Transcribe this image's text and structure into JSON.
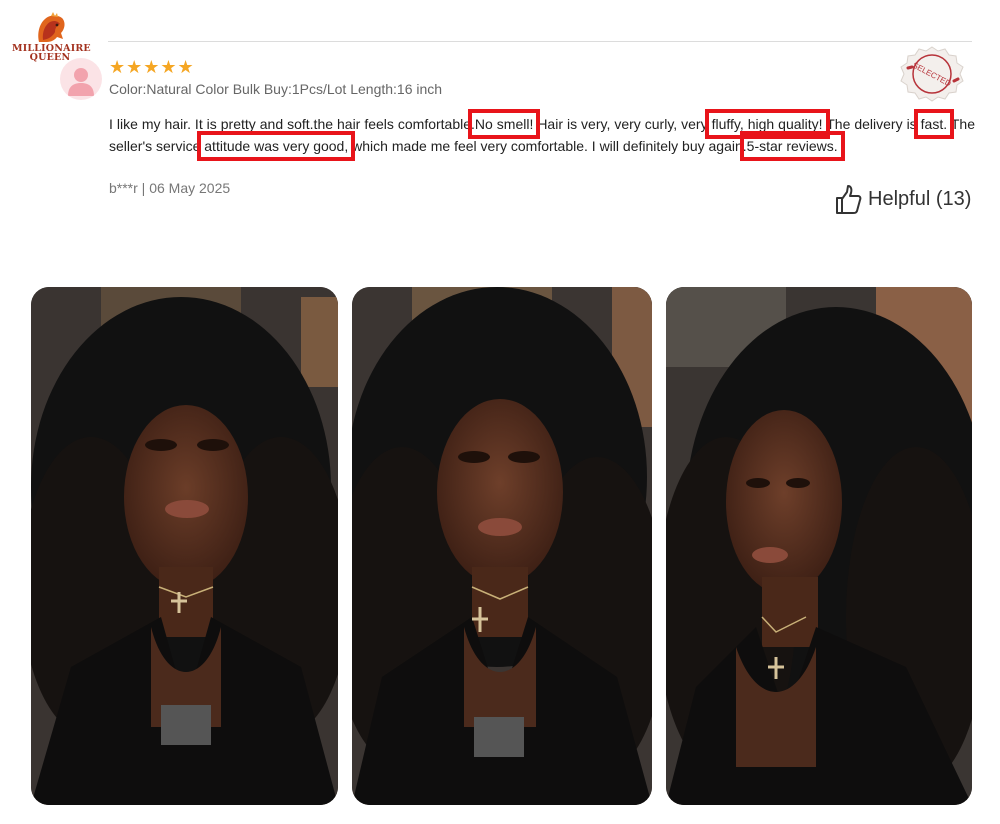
{
  "brand": {
    "line1": "MILLIONAIRE",
    "line2": "QUEEN"
  },
  "review": {
    "rating": 5,
    "stars": "★★★★★",
    "variant": "Color:Natural Color Bulk Buy:1Pcs/Lot Length:16 inch",
    "text": {
      "p1": "I like my hair. It is pretty and soft.the hair feels comfortable.",
      "h1": "No smell!",
      "p2": " Hair is very, very curly, very ",
      "h2": "fluffy, high quality!",
      "p3": " The delivery is ",
      "h3": "fast.",
      "p4": " The seller's service ",
      "h4": "attitude was very good,",
      "p5": " which made me feel very comfortable. I will definitely buy again.",
      "h5": "5-star reviews."
    },
    "author": "b***r",
    "separator": " | ",
    "date": "06 May 2025",
    "badge": "SELECTED",
    "helpful": "Helpful (13)"
  },
  "colors": {
    "highlight": "#e8141a",
    "star": "#f5a623",
    "brand": "#a3321f"
  },
  "photos": [
    {
      "name": "review-photo-1"
    },
    {
      "name": "review-photo-2"
    },
    {
      "name": "review-photo-3"
    }
  ]
}
